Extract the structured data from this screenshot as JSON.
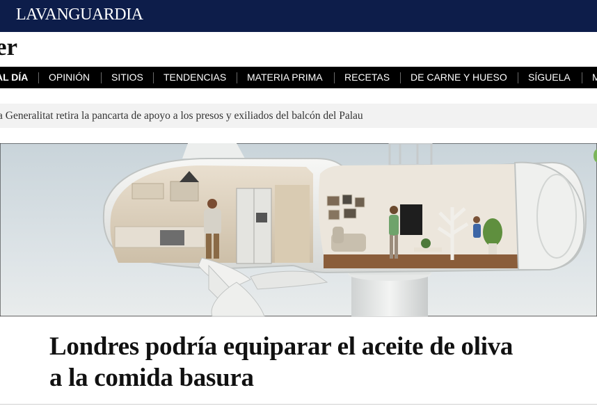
{
  "site": {
    "logo": "LAVANGUARDIA"
  },
  "section": {
    "title": "er"
  },
  "nav": {
    "items": [
      {
        "label": "AL DÍA",
        "active": true
      },
      {
        "label": "OPINIÓN"
      },
      {
        "label": "SITIOS"
      },
      {
        "label": "TENDENCIAS"
      },
      {
        "label": "MATERIA PRIMA"
      },
      {
        "label": "RECETAS"
      },
      {
        "label": "DE CARNE Y HUESO"
      },
      {
        "label": "SÍGUELA"
      },
      {
        "label": "M"
      }
    ]
  },
  "ticker": {
    "text": "a Generalitat retira la pancarta de apoyo a los presos y exiliados del balcón del Palau"
  },
  "hero": {
    "icon": "wind-turbine-home-illustration"
  },
  "article": {
    "headline_line1": "Londres podría equiparar el aceite de oliva",
    "headline_line2": "a la comida basura"
  },
  "colors": {
    "brand": "#0d1d4a",
    "nav_bg": "#000000"
  }
}
